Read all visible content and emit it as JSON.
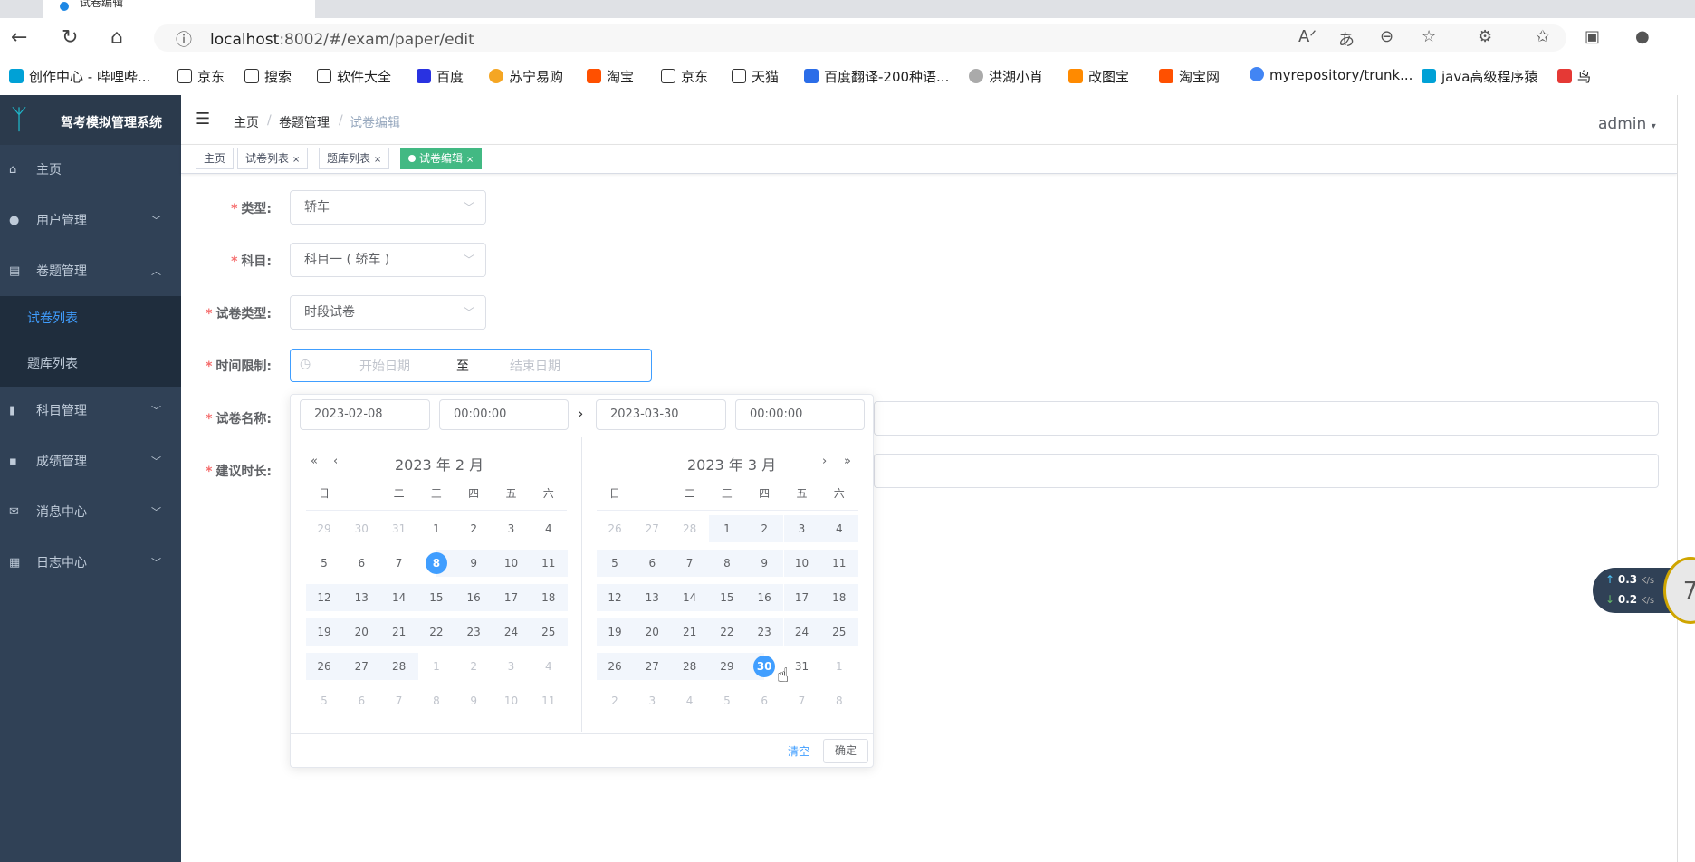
{
  "browser": {
    "tab_title": "试卷编辑",
    "url_host": "localhost",
    "url_rest": ":8002/#/exam/paper/edit",
    "bookmarks": [
      "创作中心 - 哔哩哔...",
      "京东",
      "搜索",
      "软件大全",
      "百度",
      "苏宁易购",
      "淘宝",
      "京东",
      "天猫",
      "百度翻译-200种语...",
      "洪湖小肖",
      "改图宝",
      "淘宝网",
      "myrepository/trunk...",
      "java高级程序猿",
      "鸟"
    ]
  },
  "sidebar": {
    "app_name": "驾考模拟管理系统",
    "items": [
      {
        "label": "主页"
      },
      {
        "label": "用户管理"
      },
      {
        "label": "卷题管理"
      },
      {
        "label": "试卷列表"
      },
      {
        "label": "题库列表"
      },
      {
        "label": "科目管理"
      },
      {
        "label": "成绩管理"
      },
      {
        "label": "消息中心"
      },
      {
        "label": "日志中心"
      }
    ]
  },
  "header": {
    "breadcrumb": [
      "主页",
      "卷题管理",
      "试卷编辑"
    ],
    "user": "admin"
  },
  "tags": [
    "主页",
    "试卷列表",
    "题库列表",
    "试卷编辑"
  ],
  "form": {
    "type_label": "类型:",
    "type_value": "轿车",
    "subject_label": "科目:",
    "subject_value": "科目一 ( 轿车 )",
    "paper_type_label": "试卷类型:",
    "paper_type_value": "时段试卷",
    "time_label": "时间限制:",
    "start_placeholder": "开始日期",
    "range_sep": "至",
    "end_placeholder": "结束日期",
    "name_label": "试卷名称:",
    "duration_label": "建议时长:"
  },
  "picker": {
    "start_date": "2023-02-08",
    "start_time": "00:00:00",
    "end_date": "2023-03-30",
    "end_time": "00:00:00",
    "left_title": "2023 年 2 月",
    "right_title": "2023 年 3 月",
    "weekdays": [
      "日",
      "一",
      "二",
      "三",
      "四",
      "五",
      "六"
    ],
    "left_days": [
      "29",
      "30",
      "31",
      "1",
      "2",
      "3",
      "4",
      "5",
      "6",
      "7",
      "8",
      "9",
      "10",
      "11",
      "12",
      "13",
      "14",
      "15",
      "16",
      "17",
      "18",
      "19",
      "20",
      "21",
      "22",
      "23",
      "24",
      "25",
      "26",
      "27",
      "28",
      "1",
      "2",
      "3",
      "4",
      "5",
      "6",
      "7",
      "8",
      "9",
      "10",
      "11"
    ],
    "right_days": [
      "26",
      "27",
      "28",
      "1",
      "2",
      "3",
      "4",
      "5",
      "6",
      "7",
      "8",
      "9",
      "10",
      "11",
      "12",
      "13",
      "14",
      "15",
      "16",
      "17",
      "18",
      "19",
      "20",
      "21",
      "22",
      "23",
      "24",
      "25",
      "26",
      "27",
      "28",
      "29",
      "30",
      "31",
      "1",
      "2",
      "3",
      "4",
      "5",
      "6",
      "7",
      "8"
    ],
    "clear_label": "清空",
    "ok_label": "确定"
  },
  "speed_widget": {
    "up": "0.3",
    "down": "0.2",
    "unit": "K/s",
    "badge": "7"
  },
  "colors": {
    "sidebar_bg": "#304156",
    "accent": "#409eff",
    "tag_active": "#42b983"
  }
}
